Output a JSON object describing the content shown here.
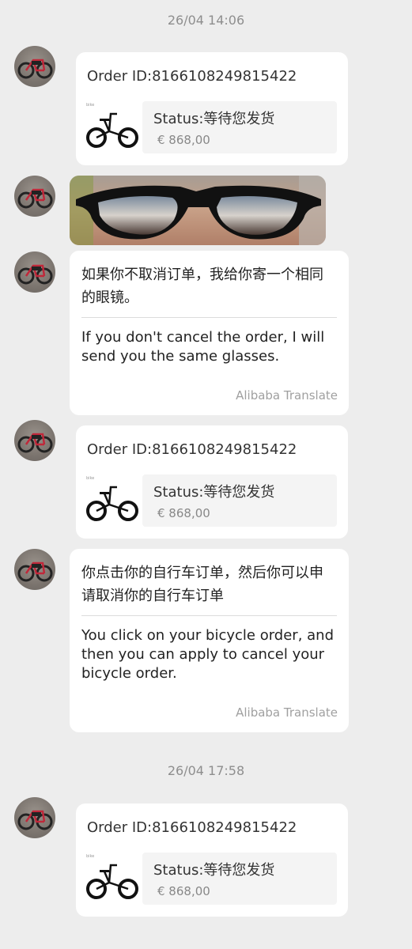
{
  "timestamps": [
    "26/04 14:06",
    "26/04 17:58"
  ],
  "order_card": {
    "order_id": "Order ID:8166108249815422",
    "status": "Status:等待您发货",
    "price": "€ 868,00"
  },
  "messages": [
    {
      "original": "如果你不取消订单，我给你寄一个相同的眼镜。",
      "translation": "If you don't cancel the order, I will send you the same glasses.",
      "translator": "Alibaba Translate"
    },
    {
      "original": "你点击你的自行车订单，然后你可以申请取消你的自行车订单",
      "translation": "You click on your bicycle order, and then you can apply to cancel your bicycle order.",
      "translator": "Alibaba Translate"
    }
  ],
  "icons": {
    "avatar": "bicycle-avatar-icon",
    "product": "folding-bike-thumbnail-icon",
    "photo": "sunglasses-photo"
  },
  "colors": {
    "background": "#ededed",
    "bubble": "#ffffff",
    "timestamp": "#8e8e8e",
    "muted_text": "#888888"
  }
}
